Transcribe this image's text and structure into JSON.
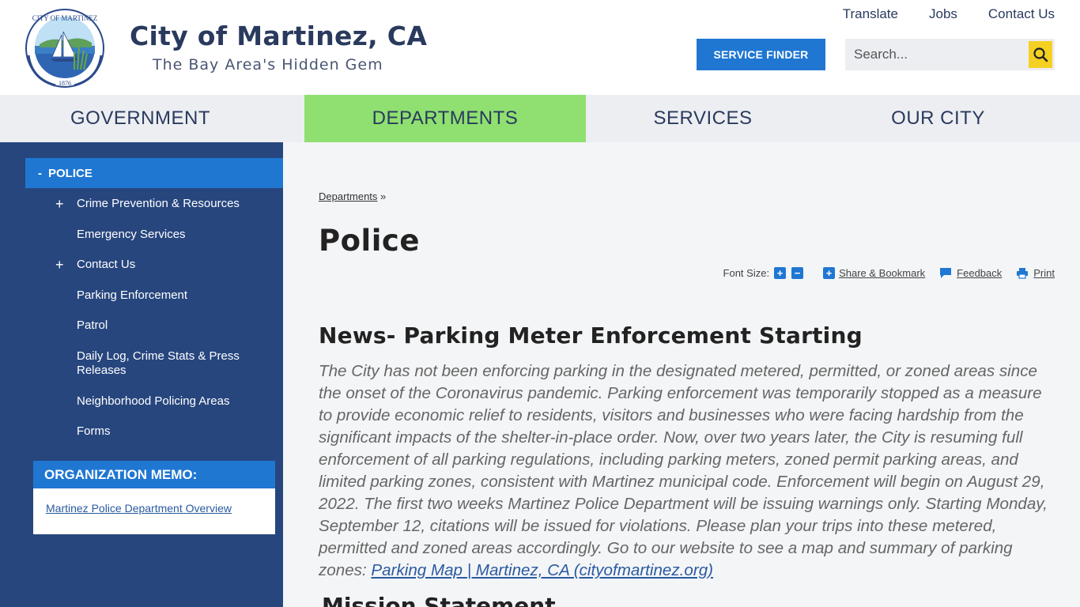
{
  "header": {
    "site_title": "City of Martinez, CA",
    "tagline": "The Bay Area's Hidden Gem",
    "seal": {
      "text_top": "CITY OF MARTINEZ",
      "year": "1876"
    },
    "top_links": [
      "Translate",
      "Jobs",
      "Contact Us"
    ],
    "service_finder_label": "SERVICE FINDER",
    "search_placeholder": "Search...",
    "search_icon": "search-icon"
  },
  "mainnav": {
    "items": [
      "GOVERNMENT",
      "DEPARTMENTS",
      "SERVICES",
      "OUR CITY"
    ],
    "active_index": 1,
    "active_color": "#8fe070"
  },
  "sidebar": {
    "current": "POLICE",
    "current_marker": "-",
    "items": [
      {
        "label": "Crime Prevention & Resources",
        "expandable": true,
        "marker": "+"
      },
      {
        "label": "Emergency Services",
        "expandable": false
      },
      {
        "label": "Contact Us",
        "expandable": true,
        "marker": "+"
      },
      {
        "label": "Parking Enforcement",
        "expandable": false
      },
      {
        "label": "Patrol",
        "expandable": false
      },
      {
        "label": "Daily Log, Crime Stats & Press Releases",
        "expandable": false
      },
      {
        "label": "Neighborhood Policing Areas",
        "expandable": false
      },
      {
        "label": "Forms",
        "expandable": false
      }
    ],
    "memo": {
      "heading": "ORGANIZATION MEMO:",
      "link": "Martinez Police Department Overview"
    }
  },
  "content": {
    "breadcrumb": {
      "link": "Departments",
      "separator": "»"
    },
    "title": "Police",
    "tools": {
      "font_size_label": "Font Size:",
      "increase": "+",
      "decrease": "−",
      "share_label": "Share & Bookmark",
      "feedback_label": "Feedback",
      "print_label": "Print"
    },
    "news": {
      "title": "News- Parking Meter Enforcement Starting",
      "body": "The City has not been enforcing parking in the designated metered, permitted, or zoned areas since the onset of the Coronavirus pandemic. Parking enforcement was temporarily stopped as a measure to provide economic relief to residents, visitors and businesses who were facing hardship from the significant impacts of the shelter-in-place order. Now, over two years later, the City is resuming full enforcement of all parking regulations, including parking meters, zoned permit parking areas, and limited parking zones, consistent with Martinez municipal code. Enforcement will begin on August 29, 2022. The first two weeks Martinez Police Department will be issuing warnings only. Starting Monday, September 12, citations will be issued for violations. Please plan your trips into these metered, permitted and zoned areas accordingly. Go to our website to see a map and summary of parking zones: ",
      "link_text": "Parking Map | Martinez, CA (cityofmartinez.org)"
    },
    "mission_title": "Mission Statement"
  },
  "colors": {
    "primary_blue": "#1f77d2",
    "sidebar_navy": "#27467e",
    "nav_gray": "#eceef2",
    "search_yellow": "#f4d023"
  }
}
